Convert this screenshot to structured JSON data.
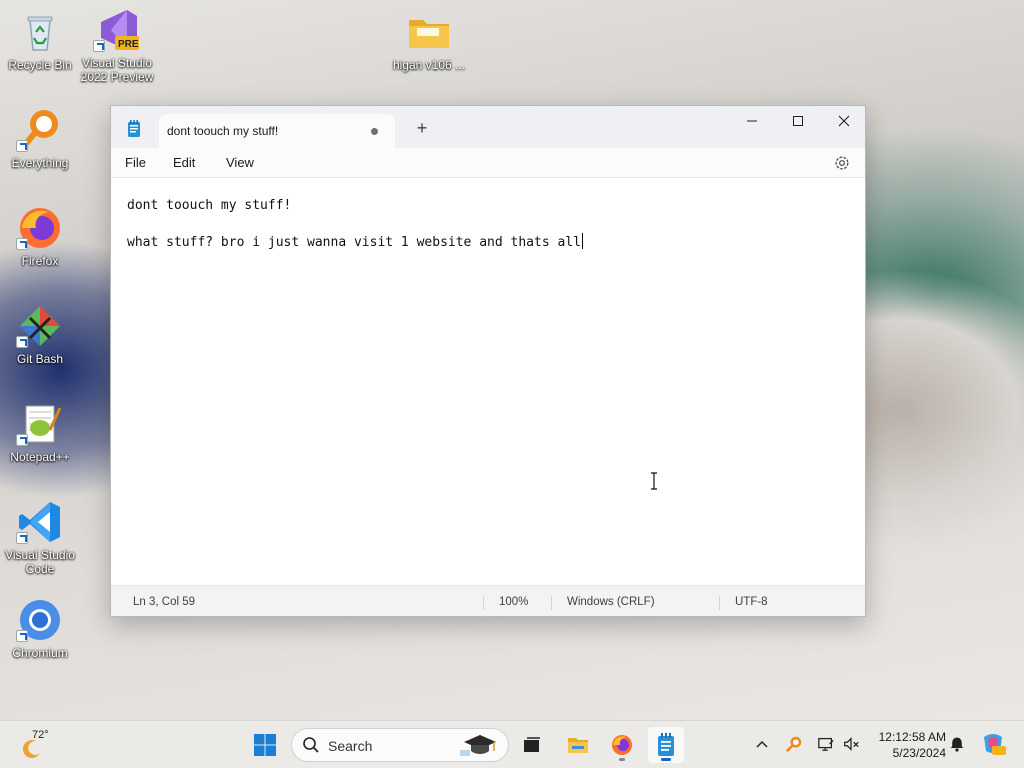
{
  "desktop": {
    "icons": [
      {
        "label": "Recycle Bin",
        "icon": "recycle-bin-icon"
      },
      {
        "label": "Visual Studio 2022 Preview",
        "icon": "visual-studio-preview-icon",
        "badge": "PRE"
      },
      {
        "label": "higan v106 ...",
        "icon": "folder-icon"
      },
      {
        "label": "Everything",
        "icon": "everything-search-icon"
      },
      {
        "label": "Firefox",
        "icon": "firefox-icon"
      },
      {
        "label": "Git Bash",
        "icon": "git-bash-icon"
      },
      {
        "label": "Notepad++",
        "icon": "notepadpp-icon"
      },
      {
        "label": "Visual Studio Code",
        "icon": "vscode-icon"
      },
      {
        "label": "Chromium",
        "icon": "chromium-icon"
      }
    ]
  },
  "notepad": {
    "tab_title": "dont toouch my stuff!",
    "menu": [
      "File",
      "Edit",
      "View"
    ],
    "lines": [
      "dont toouch my stuff!",
      "",
      "what stuff? bro i just wanna visit 1 website and thats all"
    ],
    "status": {
      "position": "Ln 3, Col 59",
      "zoom": "100%",
      "line_ending": "Windows (CRLF)",
      "encoding": "UTF-8"
    }
  },
  "taskbar": {
    "weather": {
      "temp": "72°"
    },
    "search_placeholder": "Search",
    "clock": {
      "time": "12:12:58 AM",
      "date": "5/23/2024"
    }
  },
  "colors": {
    "accent": "#1a64c8",
    "notepad_icon": "#2b8fd6"
  }
}
